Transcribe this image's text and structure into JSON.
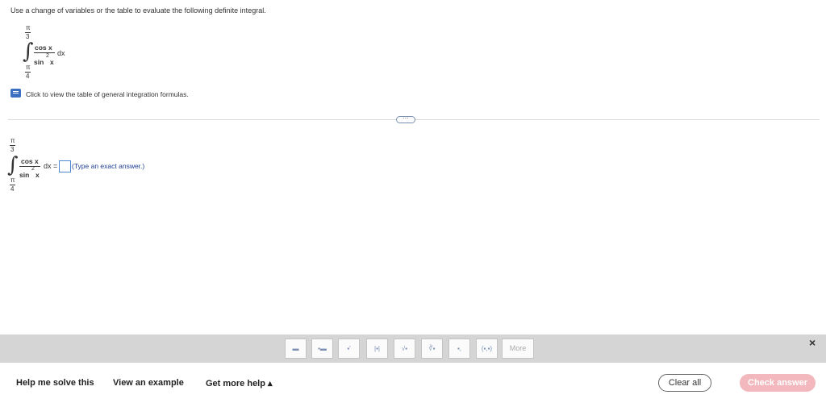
{
  "prompt": "Use a change of variables or the table to evaluate the following definite integral.",
  "integral": {
    "upper_num": "π",
    "upper_den": "3",
    "lower_num": "π",
    "lower_den": "4",
    "numerator": "cos x",
    "denominator_func": "sin",
    "denominator_exp": "2",
    "denominator_var": "x",
    "differential": "dx"
  },
  "table_link": "Click to view the table of general integration formulas.",
  "divider_handle": "⋯",
  "answer": {
    "equals": "dx =",
    "hint": "(Type an exact answer.)"
  },
  "toolbar": {
    "buttons": [
      "▬",
      "▪▬",
      "▪'",
      "|▪|",
      "√▪",
      "∛▪",
      "▪,",
      "(▪,▪)"
    ],
    "more_label": "More",
    "close_icon": "×"
  },
  "footer": {
    "help_solve": "Help me solve this",
    "view_example": "View an example",
    "more_help": "Get more help ▴",
    "clear_all": "Clear all",
    "check_answer": "Check answer"
  }
}
